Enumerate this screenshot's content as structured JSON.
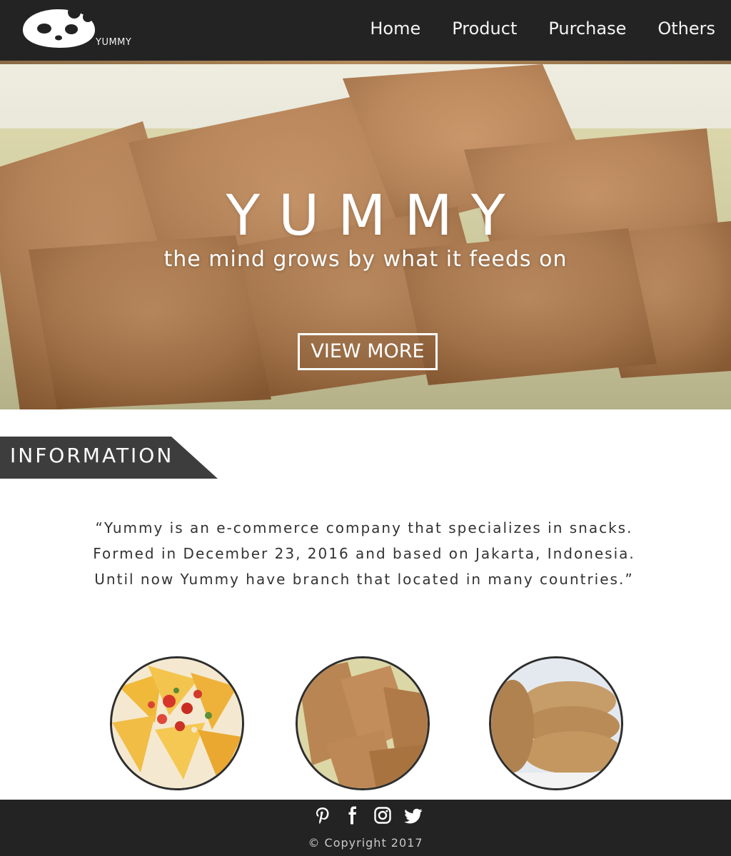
{
  "brand": {
    "name": "YUMMY"
  },
  "nav": {
    "items": [
      "Home",
      "Product",
      "Purchase",
      "Others"
    ]
  },
  "hero": {
    "title": "YUMMY",
    "tagline": "the mind grows by what it feeds on",
    "cta_label": "VIEW MORE"
  },
  "information": {
    "heading": "INFORMATION",
    "lines": [
      "“Yummy is an e-commerce company that specializes in snacks.",
      "Formed in December 23, 2016 and based on Jakarta, Indonesia.",
      "Until now Yummy have branch that located in many countries.”"
    ]
  },
  "products": [
    {
      "icon": "nachos-image"
    },
    {
      "icon": "crackers-image"
    },
    {
      "icon": "cookies-image"
    }
  ],
  "footer": {
    "social_icons": [
      "pinterest-icon",
      "facebook-icon",
      "instagram-icon",
      "twitter-icon"
    ],
    "copyright": "© Copyright 2017"
  },
  "colors": {
    "bar": "#232323",
    "accent": "#b48a5c",
    "tab": "#3d3d3d"
  }
}
